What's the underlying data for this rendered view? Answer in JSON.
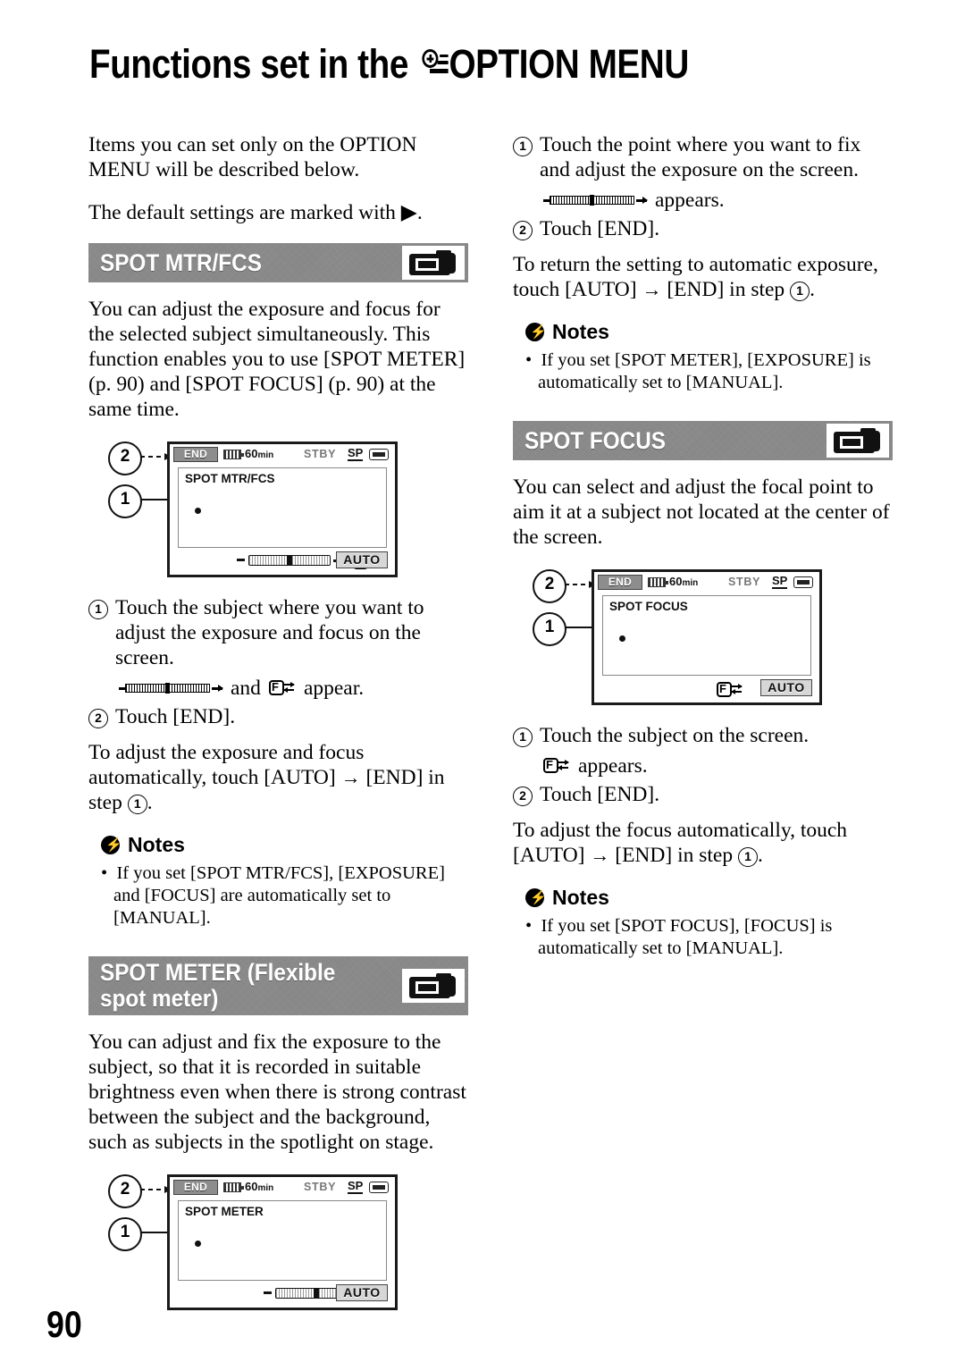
{
  "page": {
    "title_prefix": "Functions set in the ",
    "title_suffix": "OPTION MENU",
    "page_number": "90"
  },
  "intro": {
    "para1": "Items you can set only on the OPTION MENU will be described below.",
    "para2_before": "The default settings are marked with ",
    "para2_marker": "▶",
    "para2_after": "."
  },
  "sections": {
    "spot_mtr_fcs": {
      "band_label": "SPOT MTR/FCS",
      "body": "You can adjust the exposure and focus for the selected subject simultaneously. This function enables you to use [SPOT METER] (p. 90) and [SPOT FOCUS] (p. 90) at the same time.",
      "screen": {
        "end_label": "END",
        "minutes": "60",
        "minutes_unit": "min",
        "mode": "STBY",
        "quality": "SP",
        "title": "SPOT MTR/FCS",
        "auto_label": "AUTO",
        "callout_1": "1",
        "callout_2": "2",
        "has_slider": true,
        "has_focus_icon": true
      },
      "step1": "Touch the subject where you want to adjust the exposure and focus on the screen.",
      "appear_mid": " and ",
      "appear_tail": " appear.",
      "step2": "Touch [END].",
      "auto_note_a": "To adjust the exposure and focus automatically, touch [AUTO] ",
      "auto_note_arrow": "→",
      "auto_note_b": " [END] in step ",
      "auto_note_step": "1",
      "auto_note_end": ".",
      "notes_heading": "Notes",
      "notes": [
        "If you set [SPOT MTR/FCS], [EXPOSURE] and [FOCUS] are automatically set to [MANUAL]."
      ]
    },
    "spot_meter": {
      "band_label": "SPOT METER (Flexible\nspot meter)",
      "body": "You can adjust and fix the exposure to the subject, so that it is recorded in suitable brightness even when there is strong contrast between the subject and the background, such as subjects in the spotlight on stage.",
      "screen": {
        "end_label": "END",
        "minutes": "60",
        "minutes_unit": "min",
        "mode": "STBY",
        "quality": "SP",
        "title": "SPOT METER",
        "auto_label": "AUTO",
        "callout_1": "1",
        "callout_2": "2",
        "has_slider": true,
        "has_focus_icon": false
      },
      "step1": "Touch the point where you want to fix and adjust the exposure on the screen.",
      "appear_tail": " appears.",
      "step2": "Touch [END].",
      "auto_note_a": "To return the setting to automatic exposure, touch [AUTO] ",
      "auto_note_arrow": "→",
      "auto_note_b": " [END] in step ",
      "auto_note_step": "1",
      "auto_note_end": ".",
      "notes_heading": "Notes",
      "notes": [
        "If you set [SPOT METER], [EXPOSURE] is automatically set to [MANUAL]."
      ]
    },
    "spot_focus": {
      "band_label": "SPOT FOCUS",
      "body": "You can select and adjust the focal point to aim it at a subject not located at the center of the screen.",
      "screen": {
        "end_label": "END",
        "minutes": "60",
        "minutes_unit": "min",
        "mode": "STBY",
        "quality": "SP",
        "title": "SPOT FOCUS",
        "auto_label": "AUTO",
        "callout_1": "1",
        "callout_2": "2",
        "has_slider": false,
        "has_focus_icon": true
      },
      "step1": "Touch the subject on the screen.",
      "appear_tail": " appears.",
      "step2": "Touch [END].",
      "auto_note_a": "To adjust the focus automatically, touch [AUTO] ",
      "auto_note_arrow": "→",
      "auto_note_b": " [END] in step ",
      "auto_note_step": "1",
      "auto_note_end": ".",
      "notes_heading": "Notes",
      "notes": [
        "If you set [SPOT FOCUS], [FOCUS] is automatically set to [MANUAL]."
      ]
    }
  },
  "icons": {
    "option_menu": "option-menu-icon",
    "camcorder": "camcorder-icon",
    "notes_bolt": "lightning-bolt-icon",
    "exposure_bar": "exposure-slider-glyph",
    "spot_focus": "spot-focus-glyph"
  },
  "colors": {
    "band_background": "#8a8a8a",
    "band_text": "#ffffff",
    "ink": "#000000",
    "paper": "#ffffff"
  }
}
